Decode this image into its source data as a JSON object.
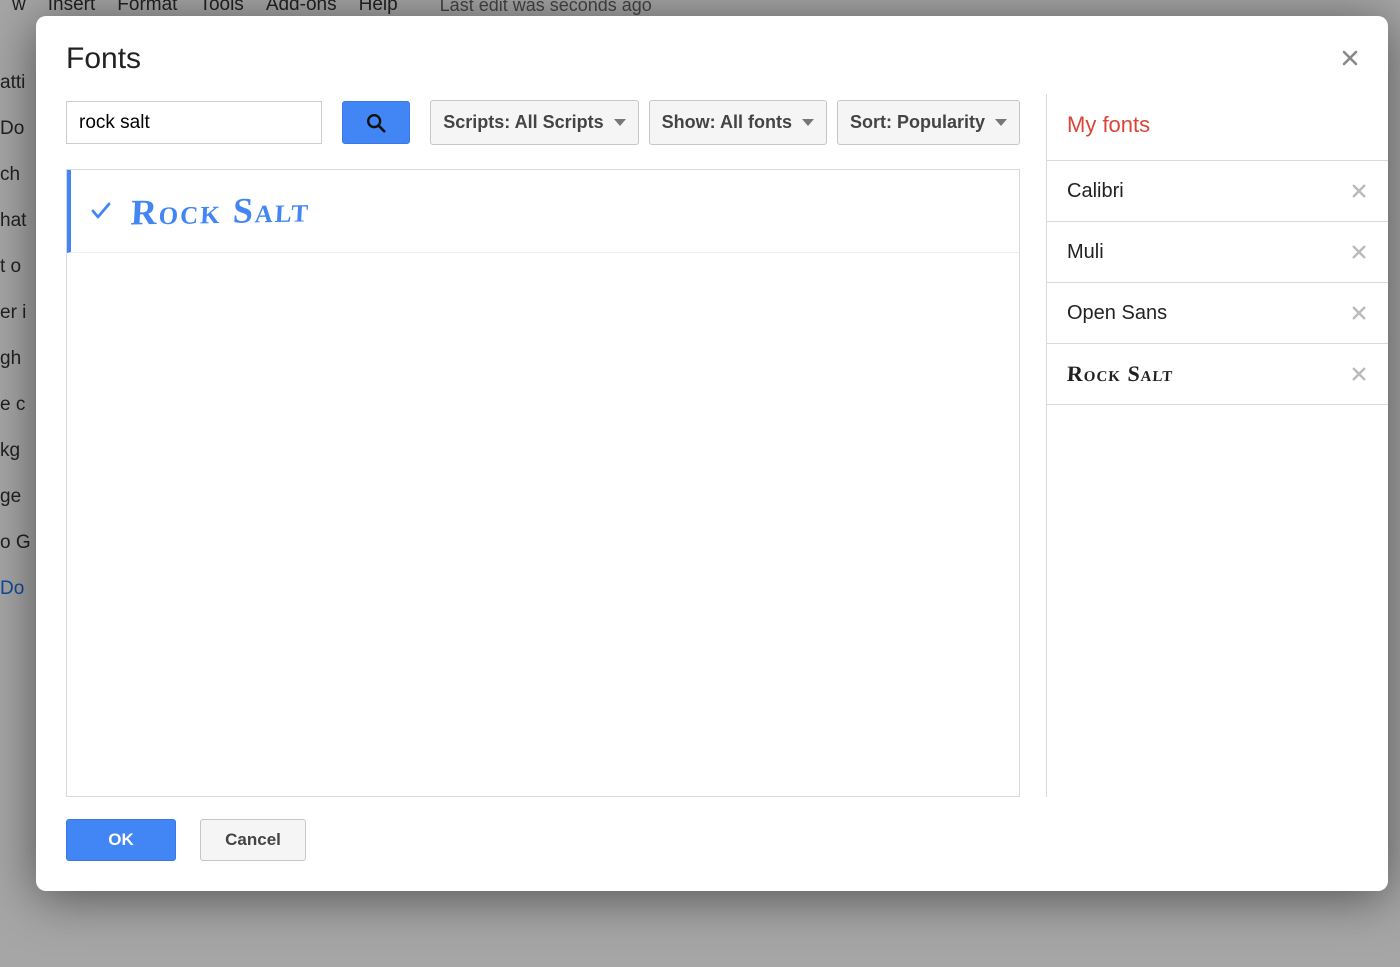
{
  "background": {
    "menubar": [
      "w",
      "Insert",
      "Format",
      "Tools",
      "Add-ons",
      "Help"
    ],
    "status": "Last edit was seconds ago",
    "side_fragments": [
      "atti",
      "Do",
      "ch",
      "hat",
      "t o",
      "er i",
      "",
      "",
      "gh",
      "e c",
      "kg",
      "ge",
      "o G",
      "Do"
    ]
  },
  "dialog": {
    "title": "Fonts",
    "search_value": "rock salt",
    "filters": {
      "scripts_label": "Scripts: All Scripts",
      "show_label": "Show: All fonts",
      "sort_label": "Sort: Popularity"
    },
    "results": [
      {
        "name": "Rock Salt",
        "selected": true,
        "style": "rock-salt-preview"
      }
    ],
    "my_fonts_title": "My fonts",
    "my_fonts": [
      {
        "name": "Calibri",
        "style": ""
      },
      {
        "name": "Muli",
        "style": ""
      },
      {
        "name": "Open Sans",
        "style": ""
      },
      {
        "name": "Rock Salt",
        "style": "rock-salt-dark"
      }
    ],
    "ok_label": "OK",
    "cancel_label": "Cancel"
  }
}
